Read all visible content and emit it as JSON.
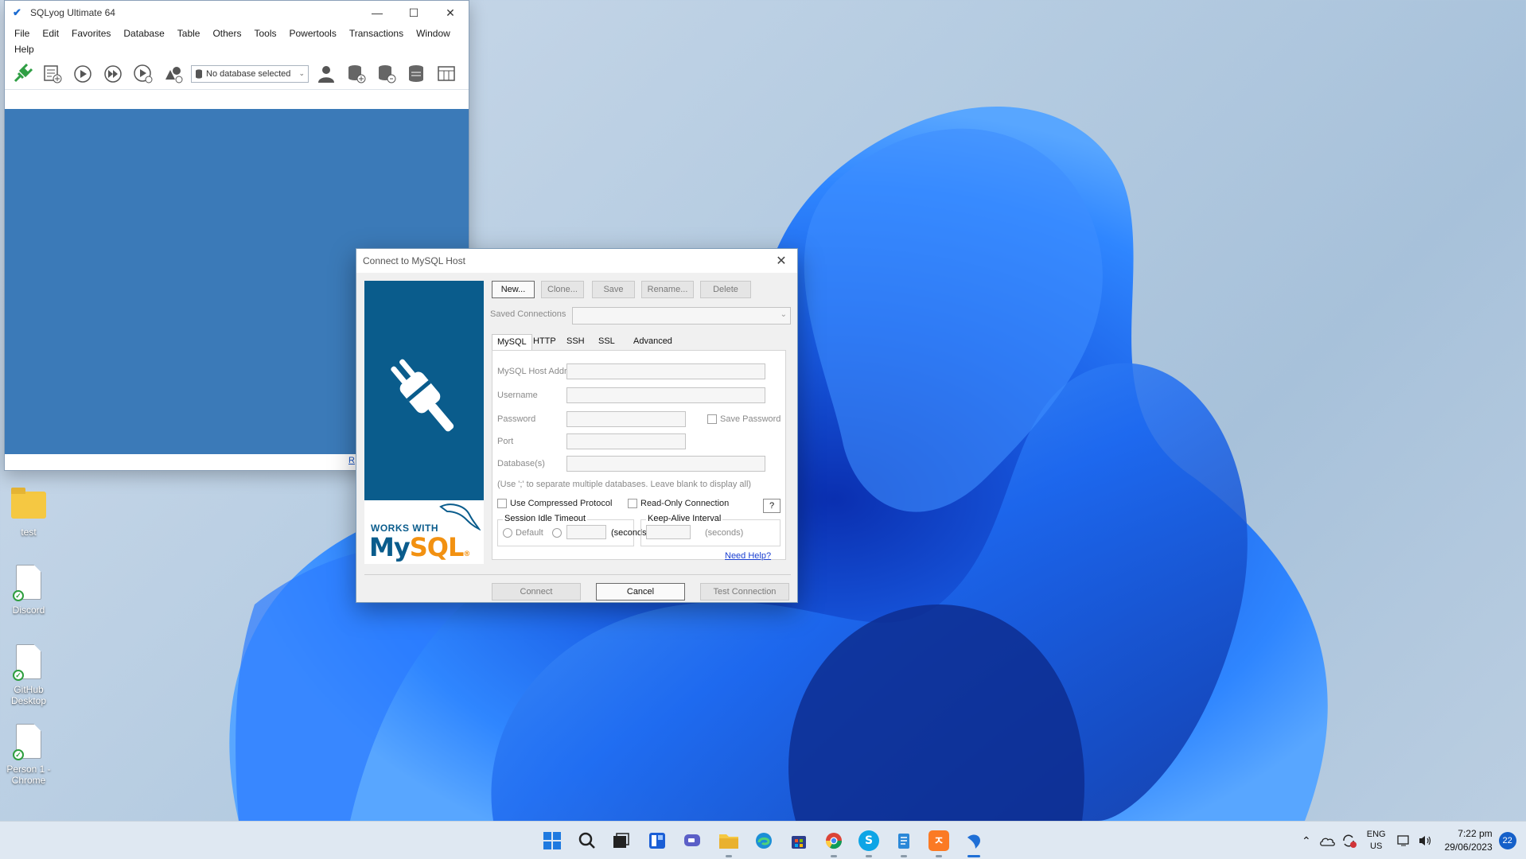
{
  "desktop": {
    "icons": [
      {
        "label": "test",
        "type": "folder-icon"
      },
      {
        "label": "Discord",
        "type": "file-icon"
      },
      {
        "label": "GitHub Desktop",
        "type": "file-icon"
      },
      {
        "label": "Person 1 - Chrome",
        "type": "file-icon"
      }
    ]
  },
  "sqlyog": {
    "title": "SQLyog Ultimate 64",
    "menu": [
      "File",
      "Edit",
      "Favorites",
      "Database",
      "Table",
      "Others",
      "Tools",
      "Powertools",
      "Transactions",
      "Window",
      "Help"
    ],
    "db_select": "No database selected",
    "status_link": "R"
  },
  "dialog": {
    "title": "Connect to MySQL Host",
    "buttons": {
      "new": "New...",
      "clone": "Clone...",
      "save": "Save",
      "rename": "Rename...",
      "delete": "Delete"
    },
    "saved_connections_label": "Saved Connections",
    "tabs": [
      "MySQL",
      "HTTP",
      "SSH",
      "SSL",
      "Advanced"
    ],
    "fields": {
      "host": "MySQL Host Address",
      "username": "Username",
      "password": "Password",
      "port": "Port",
      "databases": "Database(s)"
    },
    "save_password": "Save Password",
    "db_hint": "(Use ';' to separate multiple databases. Leave blank to display all)",
    "use_compressed": "Use Compressed Protocol",
    "read_only": "Read-Only Connection",
    "help_q": "?",
    "session_idle": {
      "title": "Session Idle Timeout",
      "default": "Default",
      "seconds": "(seconds)"
    },
    "keep_alive": {
      "title": "Keep-Alive Interval",
      "seconds": "(seconds)"
    },
    "need_help": "Need Help?",
    "footer": {
      "connect": "Connect",
      "cancel": "Cancel",
      "test": "Test Connection"
    },
    "logo": {
      "works_with": "WORKS WITH",
      "my": "My",
      "sql": "SQL",
      "reg": "®"
    }
  },
  "taskbar": {
    "icons": [
      "start-icon",
      "search-icon",
      "task-view-icon",
      "widgets-icon",
      "chat-icon",
      "file-explorer-icon",
      "edge-icon",
      "store-icon",
      "chrome-icon",
      "skype-icon",
      "notepad-icon",
      "xampp-icon",
      "sqlyog-icon"
    ],
    "lang_top": "ENG",
    "lang_bottom": "US",
    "time": "7:22 pm",
    "date": "29/06/2023",
    "notifications": "22"
  }
}
